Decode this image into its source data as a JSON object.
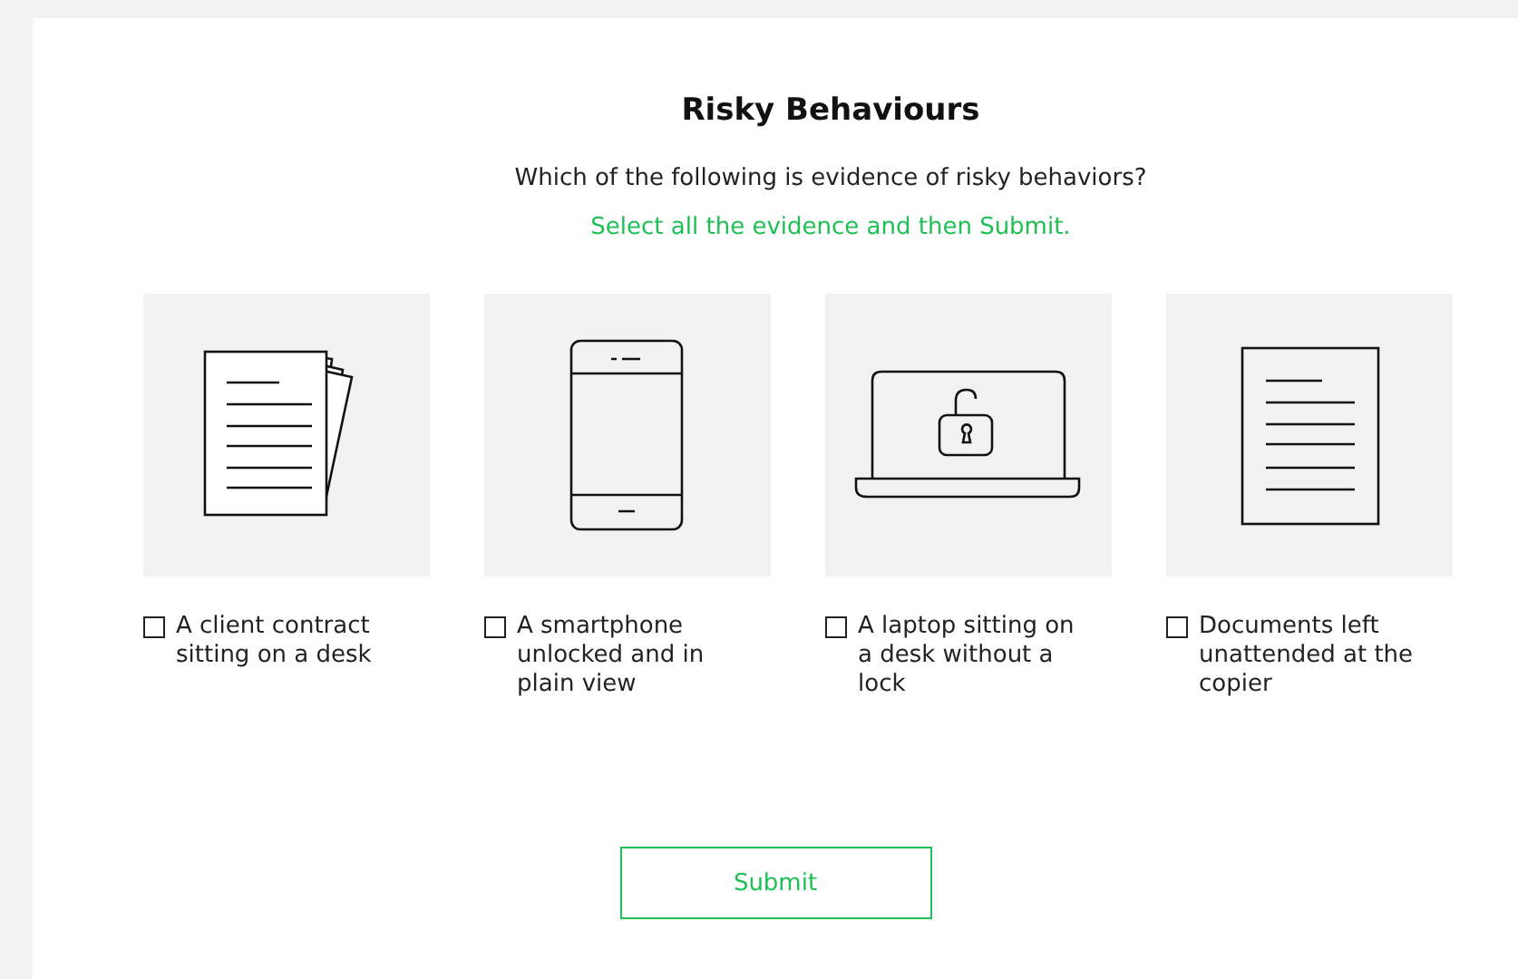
{
  "title": "Risky Behaviours",
  "question": "Which of the following is evidence of risky behaviors?",
  "instruction": "Select all the evidence and then Submit.",
  "options": [
    {
      "kind": "papers",
      "label": "A client contract sitting on a desk",
      "checked": false
    },
    {
      "kind": "phone",
      "label": "A smartphone unlocked and in plain view",
      "checked": false
    },
    {
      "kind": "laptop",
      "label": "A laptop sitting on a desk without a lock",
      "checked": false
    },
    {
      "kind": "document",
      "label": "Documents left unattended at the copier",
      "checked": false
    }
  ],
  "submit": "Submit"
}
